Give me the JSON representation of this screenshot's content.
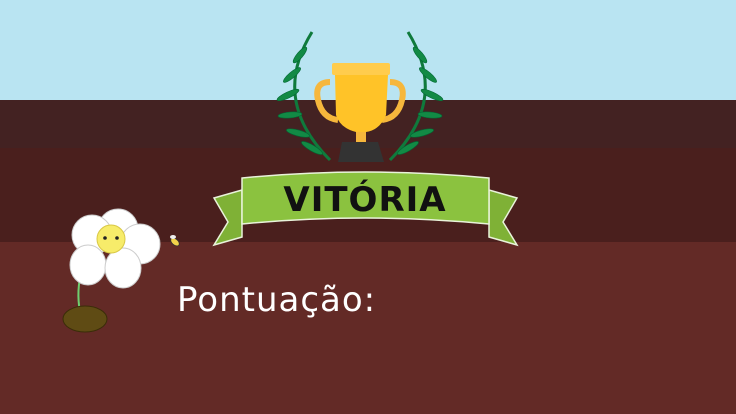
{
  "title": "VITÓRIA",
  "score_label": "Pontuação:",
  "colors": {
    "sky": "#b9e4f2",
    "ribbon": "#8bc23f",
    "trophy": "#ffc328",
    "laurel": "#0f7a3c",
    "ground": "#632a26"
  },
  "icons": [
    "trophy-icon",
    "laurel-icon",
    "flower-icon",
    "bee-icon"
  ]
}
